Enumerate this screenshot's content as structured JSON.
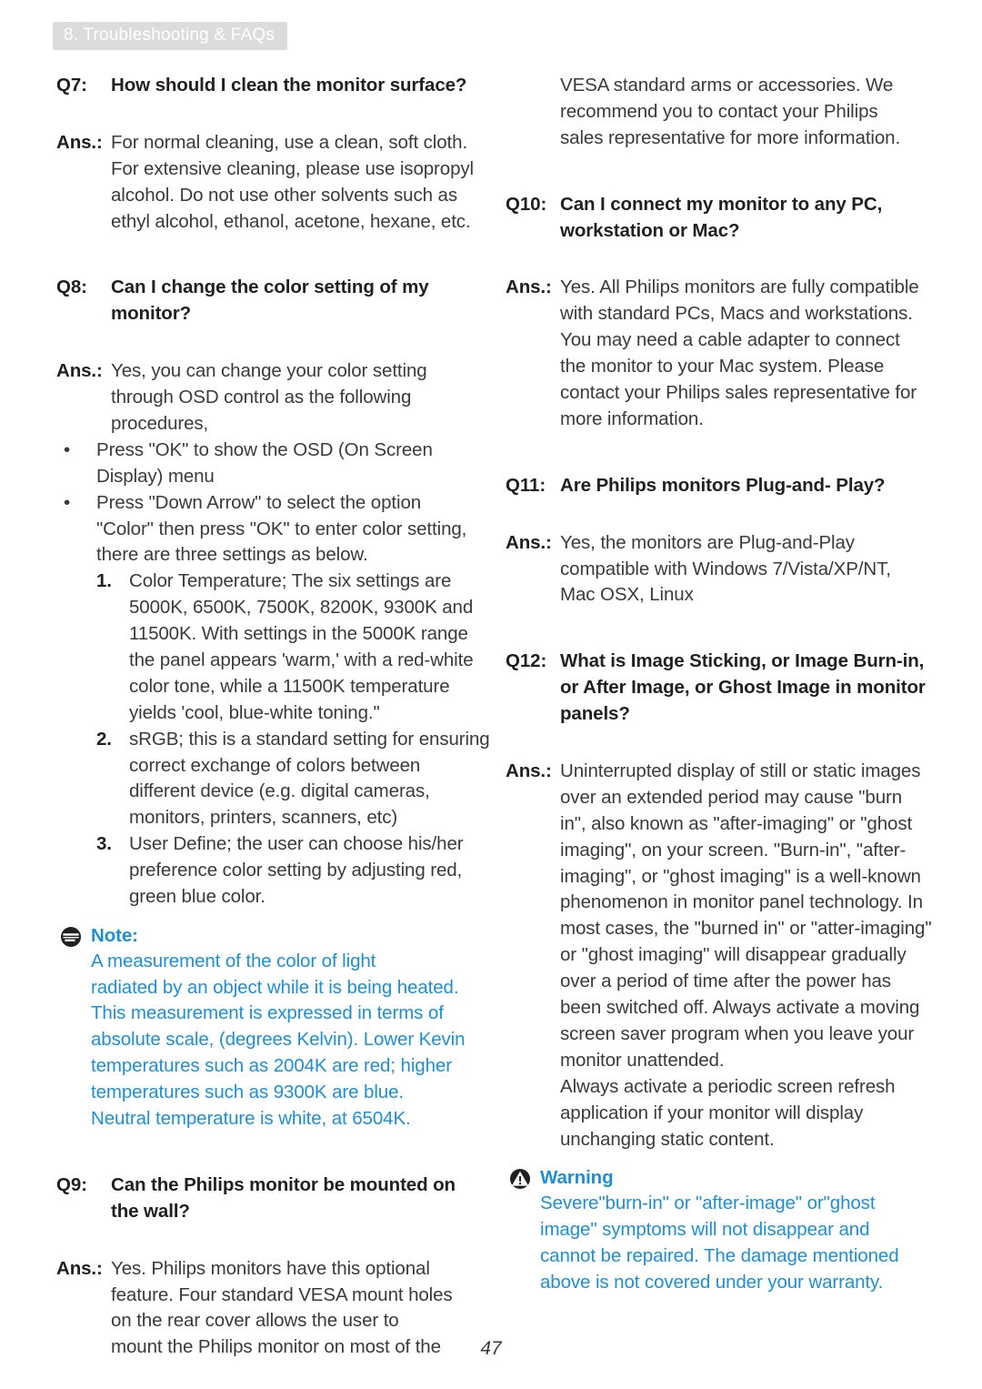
{
  "header": {
    "chapter_label": "8. Troubleshooting & FAQs"
  },
  "footer": {
    "page_number": "47"
  },
  "colors": {
    "accent_blue": "#1e8fd5",
    "header_bg": "#dcdcdc",
    "header_text": "#ffffff",
    "body_text": "#3a3a3c"
  },
  "left_column": {
    "q7": {
      "tag": "Q7:",
      "question": "How should I clean the monitor surface?",
      "ans_tag": "Ans.:",
      "answer_lines": [
        "For normal cleaning, use a clean, soft cloth.",
        "For extensive cleaning, please use isopropyl",
        "alcohol. Do not use other solvents such as",
        "ethyl alcohol, ethanol, acetone, hexane, etc."
      ]
    },
    "q8": {
      "tag": "Q8:",
      "question_lines": [
        "Can I change the color setting of my",
        "monitor?"
      ],
      "ans_tag": "Ans.:",
      "answer_lines": [
        "Yes, you can change your color setting",
        "through OSD control as the following",
        "procedures,"
      ],
      "bullets": [
        {
          "marker": "•",
          "lines": [
            "Press \"OK\" to show the OSD (On Screen",
            "Display) menu"
          ]
        },
        {
          "marker": "•",
          "lines": [
            "Press \"Down Arrow\" to select the option",
            "\"Color\" then press \"OK\" to enter color setting,",
            "there are three settings as below."
          ]
        }
      ],
      "numbered": [
        {
          "number": "1.",
          "lines": [
            "Color Temperature; The six settings are",
            "5000K, 6500K, 7500K, 8200K, 9300K and",
            "11500K. With settings in the 5000K range",
            "the panel appears 'warm,' with a red-white",
            "color tone, while a 11500K temperature",
            "yields 'cool, blue-white toning.\""
          ]
        },
        {
          "number": "2.",
          "lines": [
            "sRGB; this is a standard setting for ensuring",
            "correct exchange of colors between",
            "different device (e.g. digital cameras,",
            "monitors, printers, scanners, etc)"
          ]
        },
        {
          "number": "3.",
          "lines": [
            "User Define; the user can choose his/her",
            "preference color setting by adjusting red,",
            "green blue color."
          ]
        }
      ],
      "note": {
        "icon": "note-icon",
        "title": "Note:",
        "body_lines": [
          "A measurement of the color of light",
          "radiated by an object while it is being heated.",
          "This measurement is expressed in terms of",
          "absolute scale, (degrees Kelvin). Lower Kevin",
          "temperatures such as 2004K are red; higher",
          "temperatures such as 9300K are blue.",
          "Neutral temperature is white, at 6504K."
        ]
      }
    },
    "q9": {
      "tag": "Q9:",
      "question_lines": [
        "Can the Philips monitor be mounted on",
        "the wall?"
      ],
      "ans_tag": "Ans.:",
      "answer_lines": [
        "Yes. Philips monitors have this optional",
        "feature. Four standard VESA mount holes",
        "on the rear cover allows the user to",
        "mount the Philips monitor on most of the"
      ]
    }
  },
  "right_column": {
    "continuation_lines": [
      "VESA standard arms or accessories. We",
      "recommend you to contact your Philips",
      "sales representative for more information."
    ],
    "q10": {
      "tag": "Q10:",
      "question_lines": [
        "Can I connect my monitor to any PC,",
        "workstation or Mac?"
      ],
      "ans_tag": "Ans.:",
      "answer_lines": [
        "Yes. All Philips monitors are fully compatible",
        "with standard PCs, Macs and workstations.",
        "You may need a cable adapter to connect",
        "the monitor to your Mac system. Please",
        "contact your Philips sales representative for",
        "more information."
      ]
    },
    "q11": {
      "tag": "Q11:",
      "question_lines": [
        "Are Philips monitors Plug-and- Play?"
      ],
      "ans_tag": "Ans.:",
      "answer_lines": [
        "Yes, the monitors are Plug-and-Play",
        "compatible with Windows 7/Vista/XP/NT,",
        "Mac OSX, Linux"
      ]
    },
    "q12": {
      "tag": "Q12:",
      "question_lines": [
        "What is Image Sticking, or Image Burn-in,",
        "or After Image, or Ghost Image in monitor",
        "panels?"
      ],
      "ans_tag": "Ans.:",
      "answer_lines": [
        "Uninterrupted display of still or static images",
        "over an extended period may cause \"burn",
        "in\", also known as \"after-imaging\" or \"ghost",
        "imaging\", on your screen. \"Burn-in\", \"after-",
        "imaging\", or \"ghost imaging\" is a well-known",
        "phenomenon in monitor panel technology. In",
        "most cases, the \"burned in\" or \"atter-imaging\"",
        "or \"ghost imaging\" will disappear gradually",
        "over a period of time after the power has",
        "been switched off. Always activate a moving",
        "screen saver program when you leave your",
        "monitor unattended."
      ],
      "answer_lines_2": [
        "Always activate a periodic screen refresh",
        "application if your monitor will display",
        "unchanging static content."
      ],
      "warning": {
        "icon": "warning-icon",
        "title": "Warning",
        "body_lines": [
          "Severe\"burn-in\" or \"after-image\" or\"ghost",
          "image\" symptoms will not disappear and",
          "cannot be repaired. The damage mentioned",
          "above is not covered under your warranty."
        ]
      }
    }
  }
}
